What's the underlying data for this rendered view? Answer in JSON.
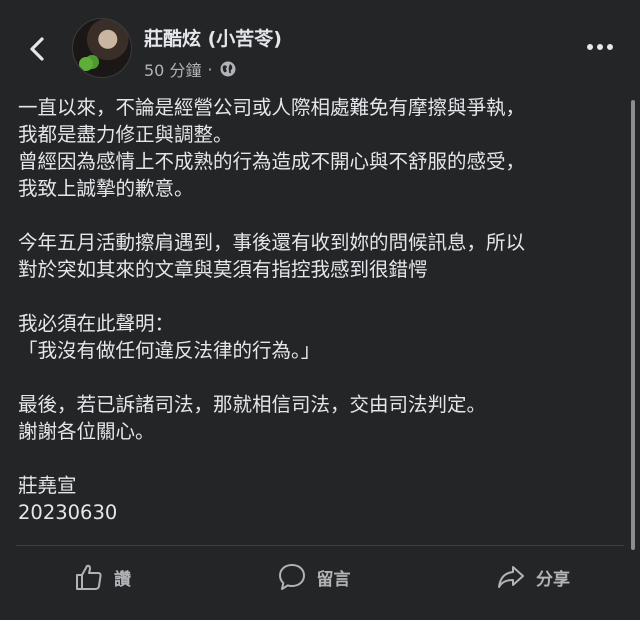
{
  "header": {
    "author_name": "莊酷炫 (小苦苓)",
    "timestamp": "50 分鐘",
    "separator": "·",
    "back_icon": "chevron-left-icon",
    "privacy_icon": "globe-icon",
    "more_icon": "more-horizontal-icon"
  },
  "post": {
    "lines": [
      "一直以來，不論是經營公司或人際相處難免有摩擦與爭執，",
      "我都是盡力修正與調整。",
      "曾經因為感情上不成熟的行為造成不開心與不舒服的感受，",
      "我致上誠摯的歉意。",
      "今年五月活動擦肩遇到，事後還有收到妳的問候訊息，所以",
      "對於突如其來的文章與莫須有指控我感到很錯愕",
      "我必須在此聲明：",
      "「我沒有做任何違反法律的行為。」",
      "最後，若已訴諸司法，那就相信司法，交由司法判定。",
      "謝謝各位關心。",
      "莊堯宣",
      "20230630"
    ]
  },
  "actions": {
    "like_label": "讚",
    "comment_label": "留言",
    "share_label": "分享"
  },
  "colors": {
    "background": "#242526",
    "text": "#e4e6eb",
    "secondary_text": "#b0b3b8"
  }
}
